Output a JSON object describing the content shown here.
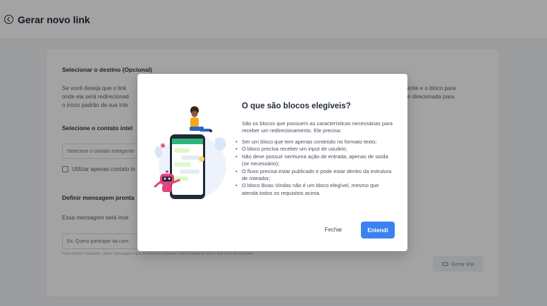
{
  "header": {
    "title": "Gerar novo link"
  },
  "form": {
    "destination_title": "Selecionar o destino (Opcional)",
    "destination_text_left": [
      "Se você deseja que o link",
      "onde ela será redirecionad",
      "o início padrão da sua inte"
    ],
    "destination_text_right": [
      "ente e o bloco para",
      "é direcionada para"
    ],
    "contact_title": "Selecione o contato intel",
    "contact_placeholder": "Selecione o contato inteligente",
    "only_contact_label": "Utilizar apenas contato in",
    "message_title": "Definir mensagem pronta",
    "message_text": "Essa mensagem será inse",
    "message_placeholder": "Ex: Quero participar da cam",
    "message_hint": "Para melhor resultado, utilize mensagens que contenham palavras relacionadas ao bloco que será direcionado",
    "generate_link_label": "Gerar link"
  },
  "modal": {
    "title": "O que são blocos elegíveis?",
    "intro": "São os blocos que possuem as características necessárias para receber um redirecionamento. Ele precisa:",
    "items": [
      "Ser um bloco que tem apenas conteúdo no formato texto;",
      "O bloco precisa receber um input de usuário;",
      "Não deve possuir nenhuma ação de entrada, apenas de saída (se necessário);",
      "O fluxo precisa estar publicado e pode estar dentro da estrutura de roteador;",
      "O bloco Boas Vindas não é um bloco elegível, mesmo que atenda todos os requisitos acima."
    ],
    "close_label": "Fechar",
    "ok_label": "Entendi"
  },
  "colors": {
    "primary": "#3b82f0",
    "overlay": "#000000"
  }
}
